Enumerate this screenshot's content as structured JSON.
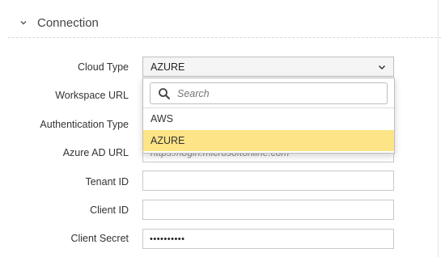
{
  "section": {
    "title": "Connection"
  },
  "form": {
    "cloud_type_label": "Cloud Type",
    "cloud_type_value": "AZURE",
    "workspace_url_label": "Workspace URL",
    "auth_type_label": "Authentication Type",
    "azure_ad_url_label": "Azure AD URL",
    "azure_ad_url_hint": "https://login.microsoftonline.com",
    "tenant_id_label": "Tenant ID",
    "client_id_label": "Client ID",
    "client_secret_label": "Client Secret",
    "client_secret_value": "••••••••••"
  },
  "dropdown": {
    "search_placeholder": "Search",
    "options": [
      "AWS",
      "AZURE"
    ],
    "selected": "AZURE",
    "highlight_color": "#fce487"
  },
  "icons": {
    "section_toggle": "chevron-down-icon",
    "select_caret": "chevron-down-icon",
    "search": "search-icon"
  }
}
